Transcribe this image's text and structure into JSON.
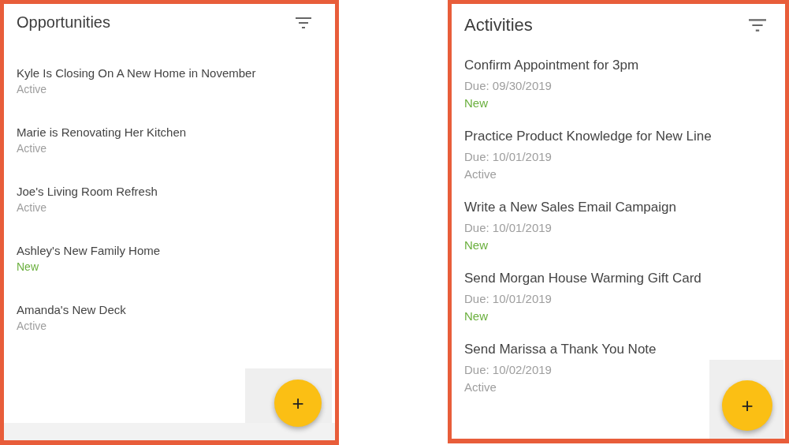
{
  "panels": [
    {
      "title": "Opportunities",
      "items": [
        {
          "title": "Kyle Is Closing On A New Home in November",
          "status": "Active",
          "color": "#9e9e9e"
        },
        {
          "title": "Marie is Renovating Her Kitchen",
          "status": "Active",
          "color": "#9e9e9e"
        },
        {
          "title": "Joe's Living Room Refresh",
          "status": "Active",
          "color": "#9e9e9e"
        },
        {
          "title": "Ashley's New Family Home",
          "status": "New",
          "color": "#6aaf3d"
        },
        {
          "title": "Amanda's New Deck",
          "status": "Active",
          "color": "#9e9e9e"
        }
      ],
      "fab": "+"
    },
    {
      "title": "Activities",
      "items": [
        {
          "title": "Confirm Appointment for 3pm",
          "due": "Due: 09/30/2019",
          "status": "New",
          "color": "#6aaf3d"
        },
        {
          "title": "Practice Product Knowledge for New Line",
          "due": "Due: 10/01/2019",
          "status": "Active",
          "color": "#9e9e9e"
        },
        {
          "title": "Write a New Sales Email Campaign",
          "due": "Due: 10/01/2019",
          "status": "New",
          "color": "#6aaf3d"
        },
        {
          "title": "Send Morgan House Warming Gift Card",
          "due": "Due: 10/01/2019",
          "status": "New",
          "color": "#6aaf3d"
        },
        {
          "title": "Send Marissa a Thank You Note",
          "due": "Due: 10/02/2019",
          "status": "Active",
          "color": "#9e9e9e"
        }
      ],
      "fab": "+"
    }
  ]
}
